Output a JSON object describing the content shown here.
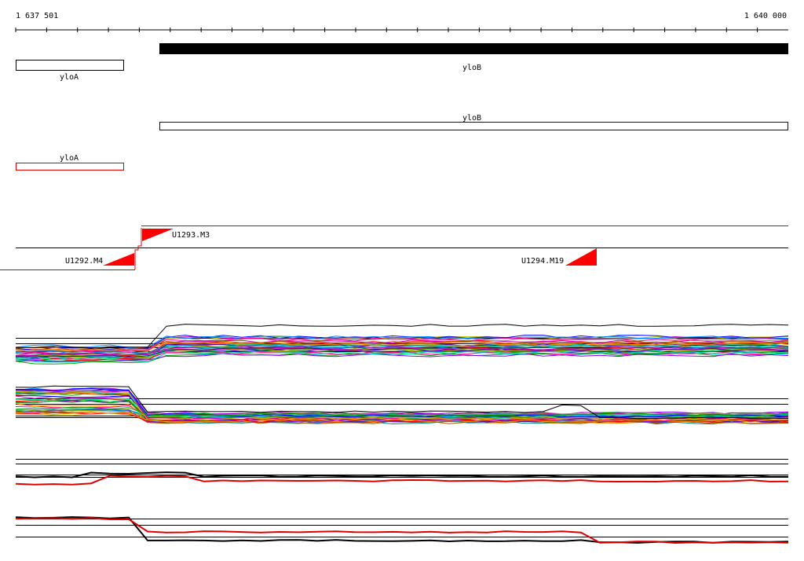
{
  "ruler": {
    "start_label": "1 637 501",
    "end_label": "1 640 000"
  },
  "genes": {
    "yloA_plus": "yloA",
    "yloB_plus": "yloB",
    "yloB_minus": "yloB",
    "yloA_minus": "yloA"
  },
  "segments": {
    "s1": "U1293.M3",
    "s2": "U1292.M4",
    "s3": "U1294.M19"
  },
  "colors": {
    "strong_feature": "#000000",
    "plus_strand": "#000000",
    "minus_strand_blue": "#0000aa",
    "minus_strand_red": "#dd0000",
    "segment_fill": "#ff0000"
  }
}
